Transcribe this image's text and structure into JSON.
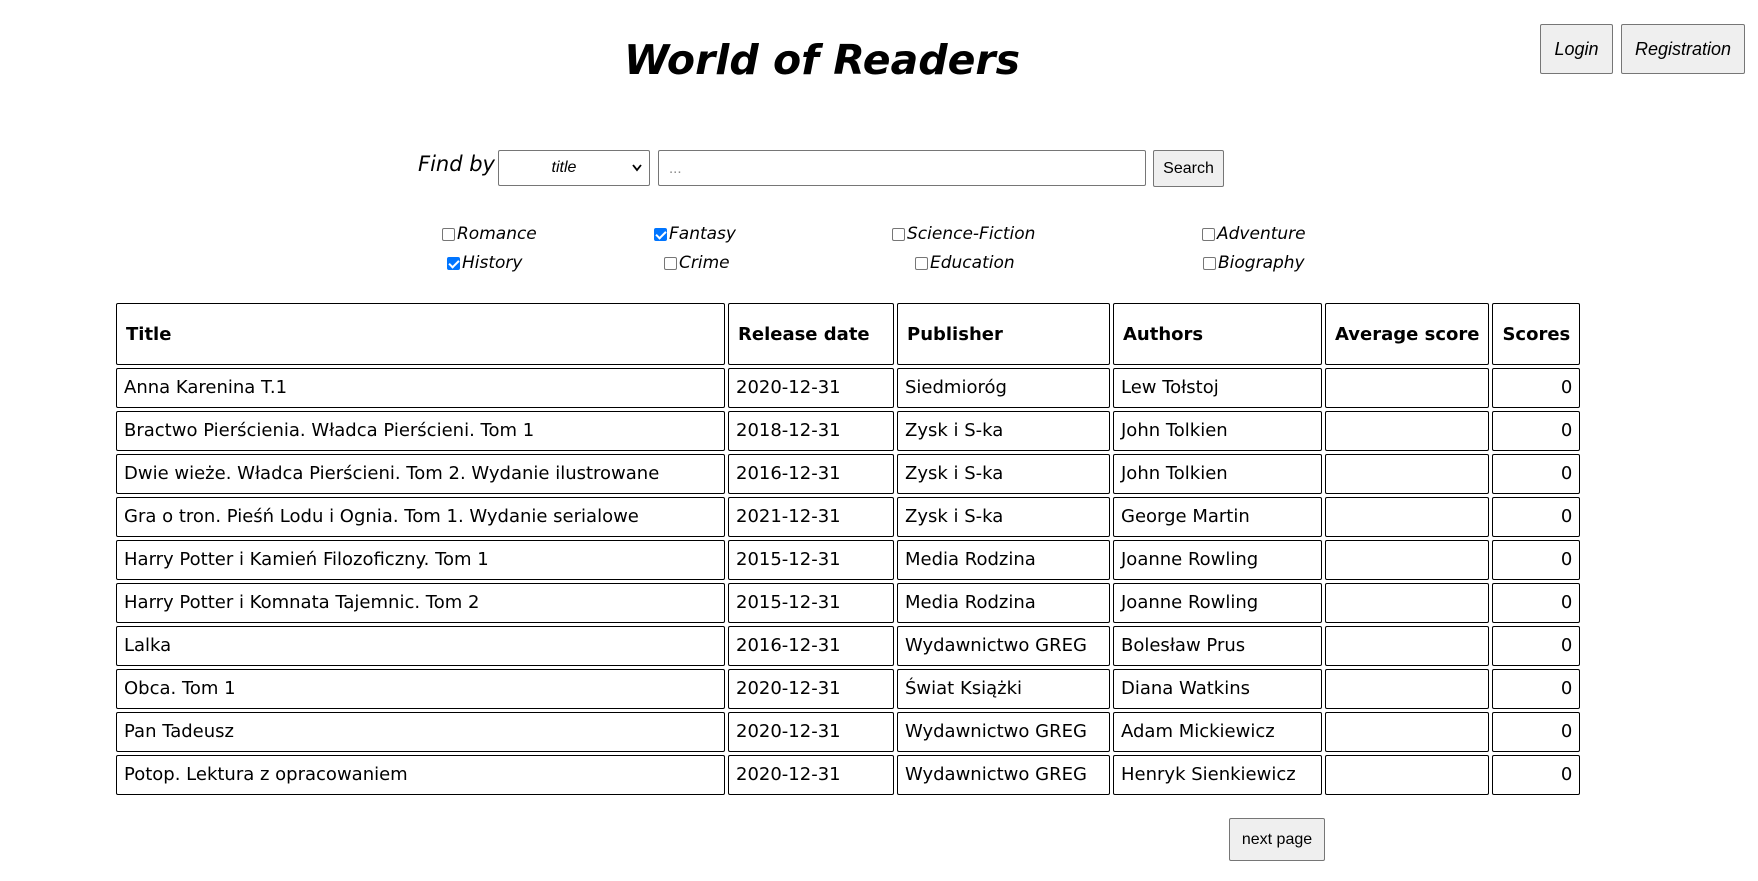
{
  "header": {
    "title": "World of Readers",
    "login_label": "Login",
    "registration_label": "Registration"
  },
  "search": {
    "find_by_label": "Find by",
    "field_selected": "title",
    "placeholder": "...",
    "value": "",
    "button_label": "Search"
  },
  "genres": [
    {
      "label": "Romance",
      "checked": false
    },
    {
      "label": "Fantasy",
      "checked": true
    },
    {
      "label": "Science-Fiction",
      "checked": false
    },
    {
      "label": "Adventure",
      "checked": false
    },
    {
      "label": "History",
      "checked": true
    },
    {
      "label": "Crime",
      "checked": false
    },
    {
      "label": "Education",
      "checked": false
    },
    {
      "label": "Biography",
      "checked": false
    }
  ],
  "table": {
    "headers": [
      "Title",
      "Release date",
      "Publisher",
      "Authors",
      "Average score",
      "Scores"
    ],
    "rows": [
      {
        "title": "Anna Karenina T.1",
        "release_date": "2020-12-31",
        "publisher": "Siedmioróg",
        "authors": "Lew Tołstoj",
        "average_score": "",
        "scores": "0"
      },
      {
        "title": "Bractwo Pierścienia. Władca Pierścieni. Tom 1",
        "release_date": "2018-12-31",
        "publisher": "Zysk i S-ka",
        "authors": "John Tolkien",
        "average_score": "",
        "scores": "0"
      },
      {
        "title": "Dwie wieże. Władca Pierścieni. Tom 2. Wydanie ilustrowane",
        "release_date": "2016-12-31",
        "publisher": "Zysk i S-ka",
        "authors": "John Tolkien",
        "average_score": "",
        "scores": "0"
      },
      {
        "title": "Gra o tron. Pieśń Lodu i Ognia. Tom 1. Wydanie serialowe",
        "release_date": "2021-12-31",
        "publisher": "Zysk i S-ka",
        "authors": "George Martin",
        "average_score": "",
        "scores": "0"
      },
      {
        "title": "Harry Potter i Kamień Filozoficzny. Tom 1",
        "release_date": "2015-12-31",
        "publisher": "Media Rodzina",
        "authors": "Joanne Rowling",
        "average_score": "",
        "scores": "0"
      },
      {
        "title": "Harry Potter i Komnata Tajemnic. Tom 2",
        "release_date": "2015-12-31",
        "publisher": "Media Rodzina",
        "authors": "Joanne Rowling",
        "average_score": "",
        "scores": "0"
      },
      {
        "title": "Lalka",
        "release_date": "2016-12-31",
        "publisher": "Wydawnictwo GREG",
        "authors": "Bolesław Prus",
        "average_score": "",
        "scores": "0"
      },
      {
        "title": "Obca. Tom 1",
        "release_date": "2020-12-31",
        "publisher": "Świat Książki",
        "authors": "Diana Watkins",
        "average_score": "",
        "scores": "0"
      },
      {
        "title": "Pan Tadeusz",
        "release_date": "2020-12-31",
        "publisher": "Wydawnictwo GREG",
        "authors": "Adam Mickiewicz",
        "average_score": "",
        "scores": "0"
      },
      {
        "title": "Potop. Lektura z opracowaniem",
        "release_date": "2020-12-31",
        "publisher": "Wydawnictwo GREG",
        "authors": "Henryk Sienkiewicz",
        "average_score": "",
        "scores": "0"
      }
    ]
  },
  "pagination": {
    "next_label": "next page"
  },
  "colors": {
    "checkbox_checked": "#0075ff",
    "button_bg": "#efefef"
  }
}
